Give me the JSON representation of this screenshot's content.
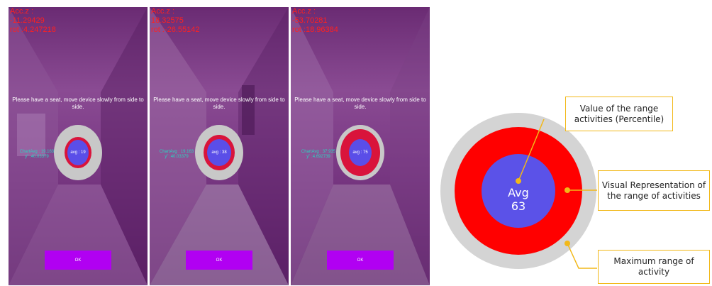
{
  "screens": [
    {
      "acc_label": "Acc.z :",
      "acc_value": "-11.29429",
      "rot_label": "rot :4.247218",
      "instruction": "Please have a seat, move device slowly from side to side.",
      "avg_label": "avg : 19",
      "chart_avg": "ChartAvg : 19.163",
      "chart_y": "y\" :40.03379",
      "ok_label": "OK"
    },
    {
      "acc_label": "Acc.z :",
      "acc_value": "18.32575",
      "rot_label": "rot :-26.55142",
      "instruction": "Please have a seat, move device slowly from side to side.",
      "avg_label": "avg : 38",
      "chart_avg": "ChartAvg : 19.163",
      "chart_y": "y\" :40.03379",
      "ok_label": "OK"
    },
    {
      "acc_label": "Acc.z :",
      "acc_value": "-53.70281",
      "rot_label": "rot :18.96384",
      "instruction": "Please have a seat, move device slowly from side to side.",
      "avg_label": "avg : 75",
      "chart_avg": "ChartAvg : 37.935",
      "chart_y": "y\" :4.692739",
      "ok_label": "OK"
    }
  ],
  "diagram": {
    "avg_label": "Avg",
    "avg_value": "63",
    "callout_value": "Value of the range activities (Percentile)",
    "callout_visual": "Visual Representation of the range of activities",
    "callout_max": "Maximum range of activity"
  },
  "colors": {
    "ring_gray": "#d4d4d4",
    "ring_red": "#ff0000",
    "inner_blue": "#5b52e8",
    "callout_border": "#f2b818",
    "debug_text": "#ff2020",
    "ok_button": "#b100f2"
  }
}
